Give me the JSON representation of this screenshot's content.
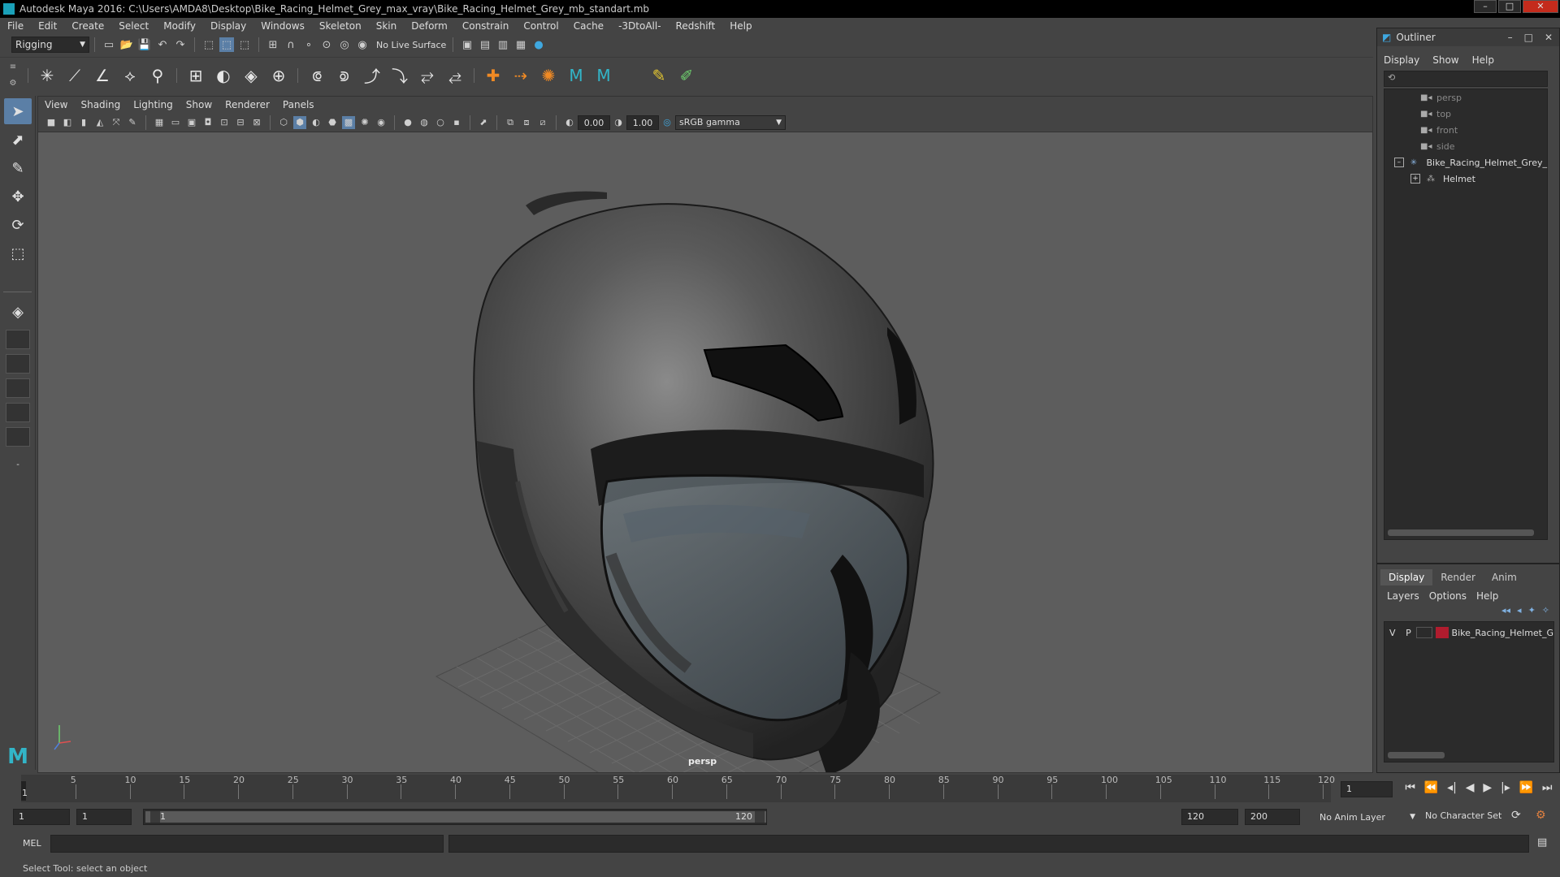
{
  "window": {
    "title": "Autodesk Maya 2016: C:\\Users\\AMDA8\\Desktop\\Bike_Racing_Helmet_Grey_max_vray\\Bike_Racing_Helmet_Grey_mb_standart.mb",
    "min": "–",
    "max": "□",
    "close": "✕"
  },
  "menubar": [
    "File",
    "Edit",
    "Create",
    "Select",
    "Modify",
    "Display",
    "Windows",
    "Skeleton",
    "Skin",
    "Deform",
    "Constrain",
    "Control",
    "Cache",
    "-3DtoAll-",
    "Redshift",
    "Help"
  ],
  "statusline": {
    "mode": "Rigging",
    "live_surface": "No Live Surface"
  },
  "viewport": {
    "menus": [
      "View",
      "Shading",
      "Lighting",
      "Show",
      "Renderer",
      "Panels"
    ],
    "exposure": "0.00",
    "gamma": "1.00",
    "color_space": "sRGB gamma",
    "camera_label": "persp"
  },
  "outliner": {
    "title": "Outliner",
    "menus": [
      "Display",
      "Show",
      "Help"
    ],
    "items": [
      {
        "label": "persp",
        "dim": true,
        "indent": 1
      },
      {
        "label": "top",
        "dim": true,
        "indent": 1
      },
      {
        "label": "front",
        "dim": true,
        "indent": 1
      },
      {
        "label": "side",
        "dim": true,
        "indent": 1
      },
      {
        "label": "Bike_Racing_Helmet_Grey_",
        "dim": false,
        "indent": 0
      },
      {
        "label": "Helmet",
        "dim": false,
        "indent": 2
      }
    ]
  },
  "layer_editor": {
    "tabs": [
      "Display",
      "Render",
      "Anim"
    ],
    "active_tab": "Display",
    "menus": [
      "Layers",
      "Options",
      "Help"
    ],
    "layer": {
      "v": "V",
      "p": "P",
      "name": "Bike_Racing_Helmet_G",
      "color": "#b01c2e"
    }
  },
  "timeline": {
    "ticks": [
      "5",
      "10",
      "15",
      "20",
      "25",
      "30",
      "35",
      "40",
      "45",
      "50",
      "55",
      "60",
      "65",
      "70",
      "75",
      "80",
      "85",
      "90",
      "95",
      "100",
      "105",
      "110",
      "115",
      "120"
    ],
    "current_frame_marker": "1",
    "current_frame_field": "1"
  },
  "range": {
    "start": "1",
    "playback_start": "1",
    "slider_start": "1",
    "slider_end": "120",
    "playback_end": "120",
    "end": "200",
    "anim_layer": "No Anim Layer",
    "character_set": "No Character Set"
  },
  "cmdline": {
    "lang": "MEL"
  },
  "helpline": {
    "text": "Select Tool: select an object"
  }
}
